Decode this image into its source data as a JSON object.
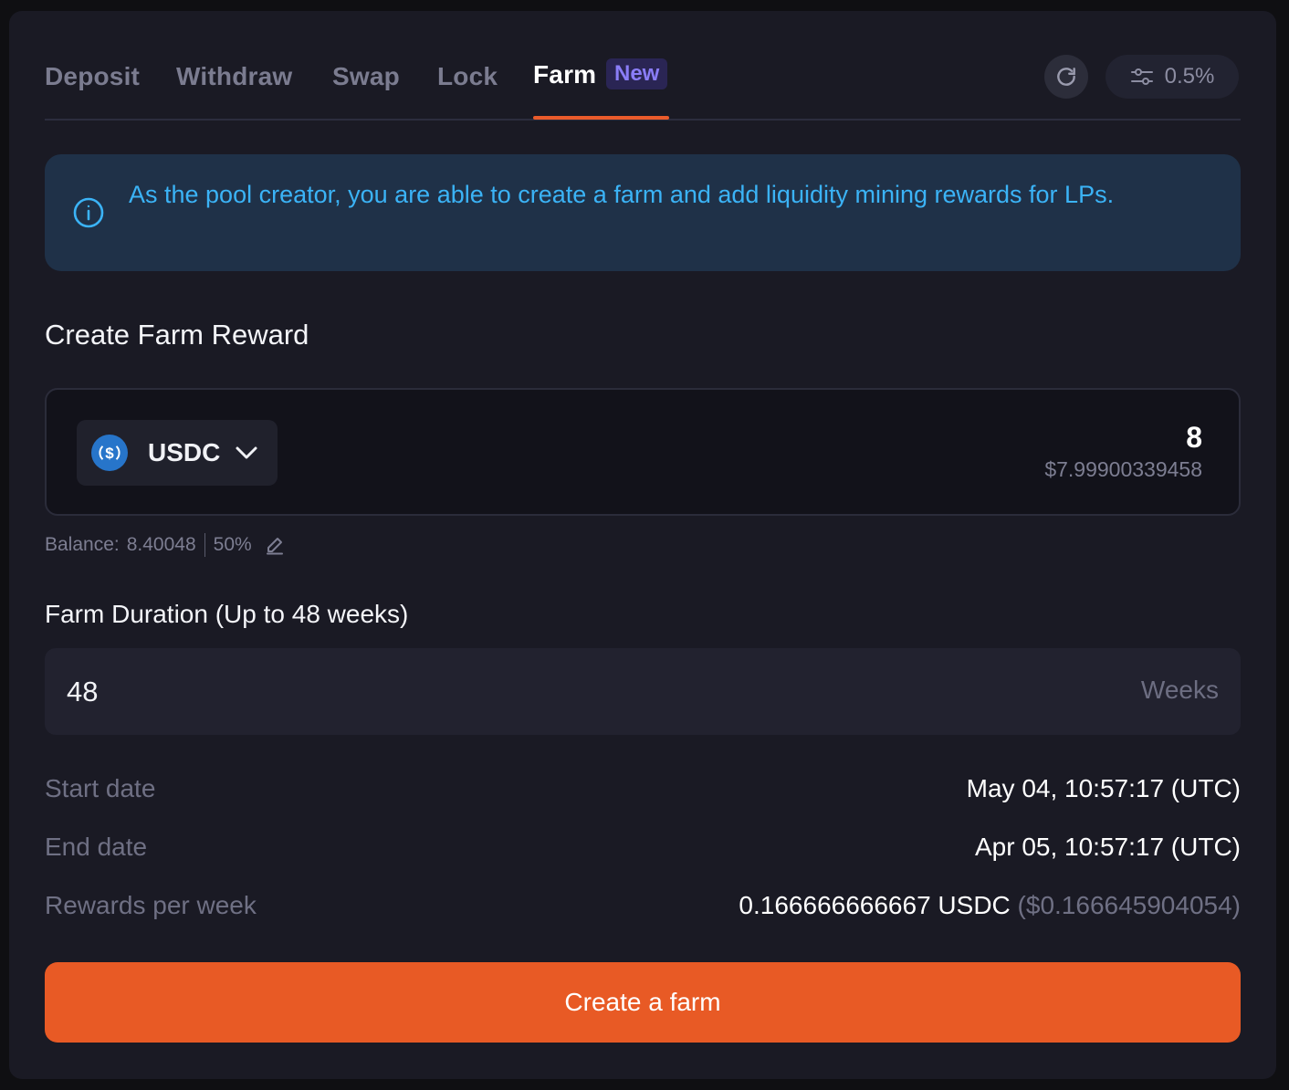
{
  "tabs": [
    {
      "label": "Deposit"
    },
    {
      "label": "Withdraw"
    },
    {
      "label": "Swap"
    },
    {
      "label": "Lock"
    },
    {
      "label": "Farm",
      "badge": "New",
      "active": true
    }
  ],
  "header": {
    "refresh_icon": "refresh-icon",
    "slippage_icon": "sliders-icon",
    "slippage": "0.5%"
  },
  "banner": {
    "icon": "info-icon",
    "text": "As the pool creator, you are able to create a farm and add liquidity mining rewards for LPs."
  },
  "reward": {
    "title": "Create Farm Reward",
    "token_symbol": "USDC",
    "token_icon": "usdc-icon",
    "amount": "8",
    "amount_usd": "$7.99900339458",
    "balance_label": "Balance:",
    "balance_value": "8.40048",
    "percent": "50%"
  },
  "duration": {
    "label": "Farm Duration (Up to 48 weeks)",
    "value": "48",
    "unit": "Weeks"
  },
  "details": {
    "start_label": "Start date",
    "start_value": "May 04, 10:57:17 (UTC)",
    "end_label": "End date",
    "end_value": "Apr 05, 10:57:17 (UTC)",
    "rewards_label": "Rewards per week",
    "rewards_value": "0.166666666667 USDC",
    "rewards_usd": "($0.166645904054)"
  },
  "actions": {
    "create_label": "Create a farm"
  },
  "colors": {
    "accent": "#e85a25",
    "banner_text": "#3bb3f6",
    "badge": "#8a7df7"
  }
}
